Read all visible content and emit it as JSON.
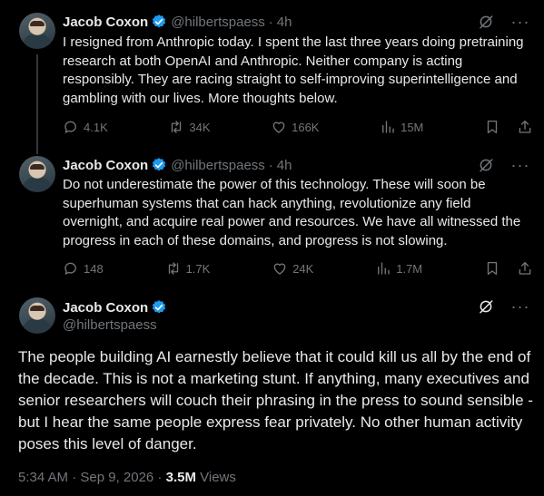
{
  "tweets": [
    {
      "author": "Jacob Coxon",
      "handle": "@hilbertspaess",
      "time": "4h",
      "dot": "·",
      "text": "I resigned from Anthropic today. I spent the last three years doing pretraining research at both OpenAI and Anthropic. Neither company is acting responsibly. They are racing straight to self-improving superintelligence and gambling with our lives. More thoughts below.",
      "replies": "4.1K",
      "retweets": "34K",
      "likes": "166K",
      "views": "15M"
    },
    {
      "author": "Jacob Coxon",
      "handle": "@hilbertspaess",
      "time": "4h",
      "dot": "·",
      "text": "Do not underestimate the power of this technology. These will soon be superhuman systems that can hack anything, revolutionize any field overnight, and acquire real power and resources. We have all witnessed the progress in each of these domains, and progress is not slowing.",
      "replies": "148",
      "retweets": "1.7K",
      "likes": "24K",
      "views": "1.7M"
    }
  ],
  "main_tweet": {
    "author": "Jacob Coxon",
    "handle": "@hilbertspaess",
    "text": "The people building AI earnestly believe that it could kill us all by the end of the decade. This is not a marketing stunt. If anything, many executives and senior researchers will couch their phrasing in the press to sound sensible - but I hear the same people express fear privately. No other human activity poses this level of danger.",
    "timestamp": "5:34 AM · Sep 9, 2026 · ",
    "views_count": "3.5M",
    "views_label": " Views"
  },
  "icons": {
    "more": "···",
    "verified_color": "#1d9bf0"
  }
}
